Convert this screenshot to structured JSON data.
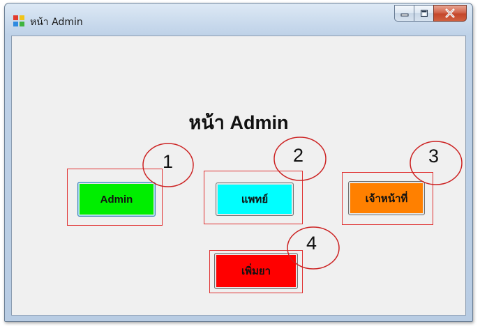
{
  "window": {
    "title": "หน้า Admin",
    "caption_buttons": [
      "minimize",
      "maximize",
      "close"
    ]
  },
  "form": {
    "heading": "หน้า Admin",
    "buttons": [
      {
        "label": "Admin",
        "color": "#00ee00",
        "focused": true
      },
      {
        "label": "แพทย์",
        "color": "#00ffff",
        "focused": false
      },
      {
        "label": "เจ้าหน้าที่",
        "color": "#ff8000",
        "focused": false
      },
      {
        "label": "เพิ่มยา",
        "color": "#ff0000",
        "focused": false
      }
    ]
  },
  "annotations": {
    "numbers": [
      "1",
      "2",
      "3",
      "4"
    ],
    "circle_color": "#cc2222",
    "box_color": "#e03030"
  },
  "icons": {
    "app": "windows-forms-app-icon",
    "minimize": "minimize-icon",
    "maximize": "maximize-icon",
    "close": "close-x-icon"
  }
}
